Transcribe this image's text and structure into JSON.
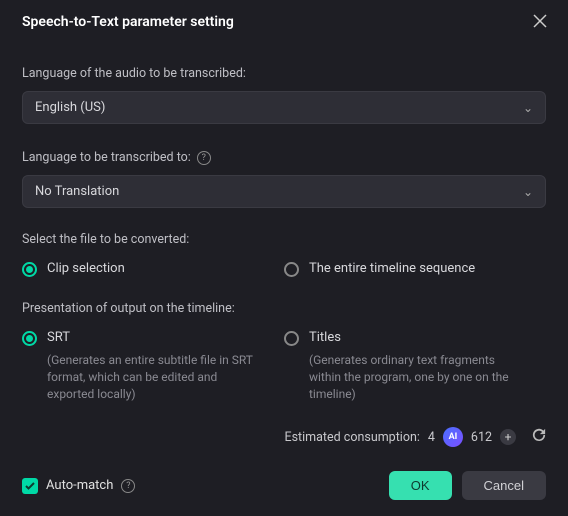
{
  "header": {
    "title": "Speech-to-Text parameter setting"
  },
  "audio_lang": {
    "label": "Language of the audio to be transcribed:",
    "value": "English (US)"
  },
  "target_lang": {
    "label": "Language to be transcribed to:",
    "value": "No Translation"
  },
  "file_select": {
    "label": "Select the file to be converted:",
    "options": {
      "clip": "Clip selection",
      "timeline": "The entire timeline sequence"
    },
    "selected": "clip"
  },
  "output": {
    "label": "Presentation of output on the timeline:",
    "options": {
      "srt": {
        "label": "SRT",
        "desc": "(Generates an entire subtitle file in SRT format, which can be edited and exported locally)"
      },
      "titles": {
        "label": "Titles",
        "desc": "(Generates ordinary text fragments within the program, one by one on the timeline)"
      }
    },
    "selected": "srt"
  },
  "estimate": {
    "label": "Estimated consumption:",
    "value": "4",
    "credits": "612"
  },
  "auto_match": {
    "label": "Auto-match",
    "checked": true
  },
  "buttons": {
    "ok": "OK",
    "cancel": "Cancel"
  }
}
